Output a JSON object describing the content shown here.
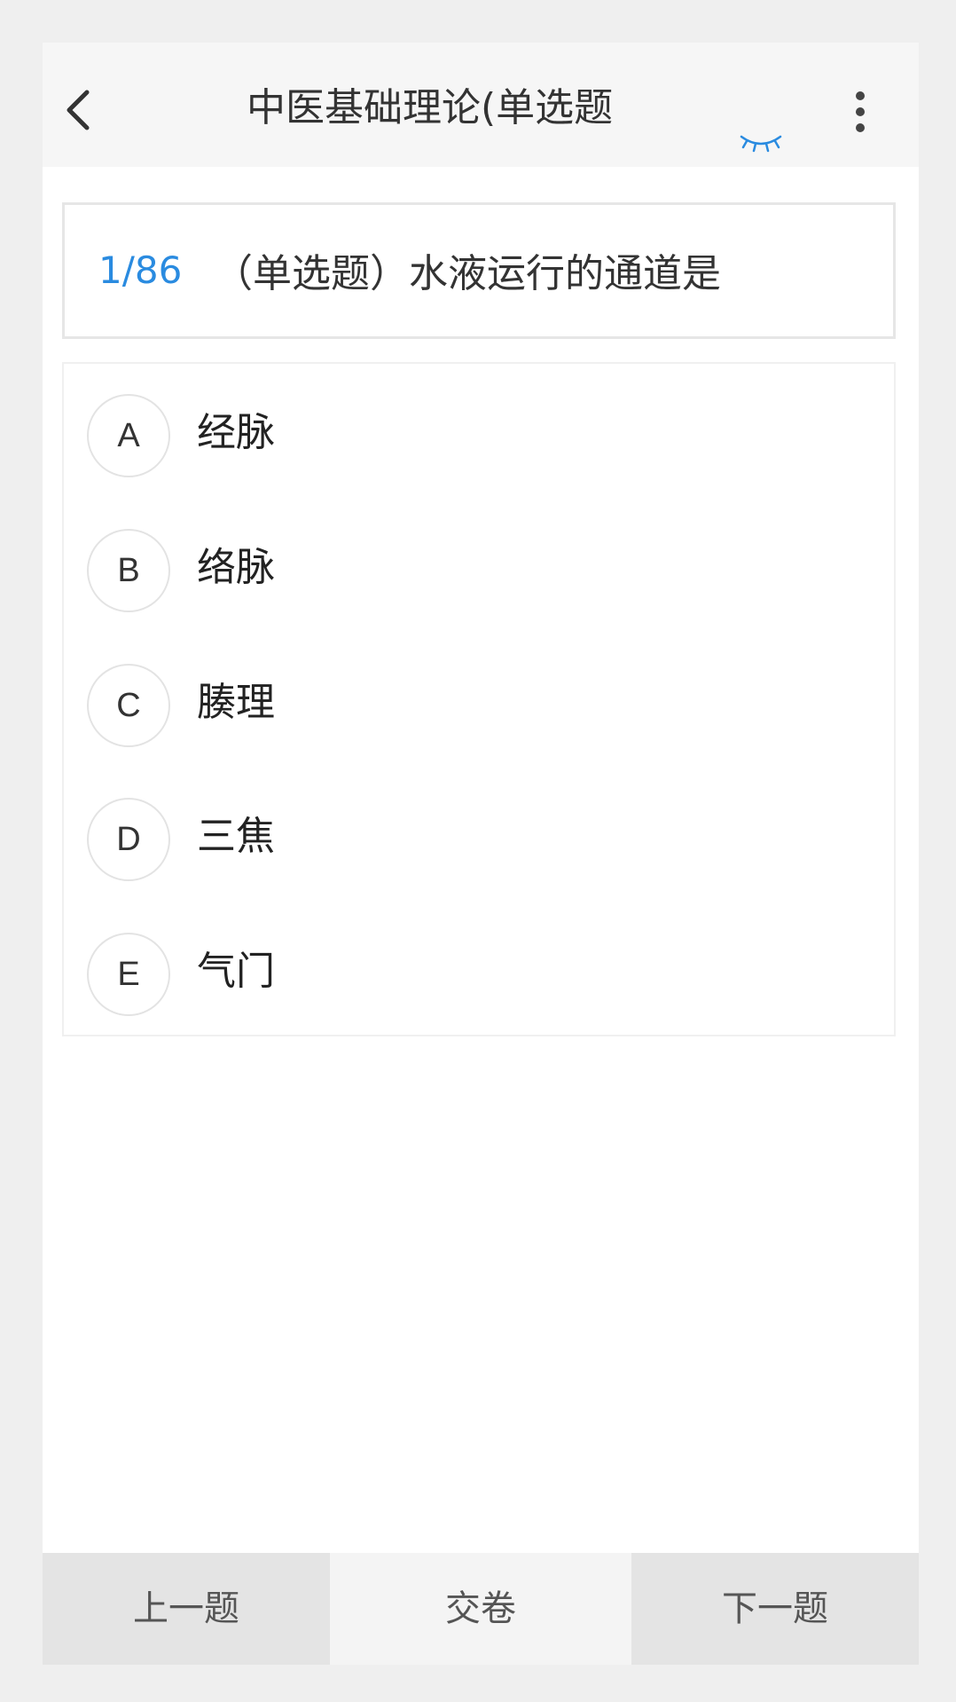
{
  "header": {
    "title": "中医基础理论(单选题",
    "icons": [
      "back-arrow-icon",
      "eye-closed-icon",
      "more-vertical-icon"
    ],
    "accent_color": "#2a8be0"
  },
  "question": {
    "index": "1/86",
    "text": "（单选题）水液运行的通道是"
  },
  "options": [
    {
      "letter": "A",
      "text": "经脉"
    },
    {
      "letter": "B",
      "text": "络脉"
    },
    {
      "letter": "C",
      "text": "腠理"
    },
    {
      "letter": "D",
      "text": "三焦"
    },
    {
      "letter": "E",
      "text": "气门"
    }
  ],
  "footer": {
    "prev_label": "上一题",
    "submit_label": "交卷",
    "next_label": "下一题"
  }
}
